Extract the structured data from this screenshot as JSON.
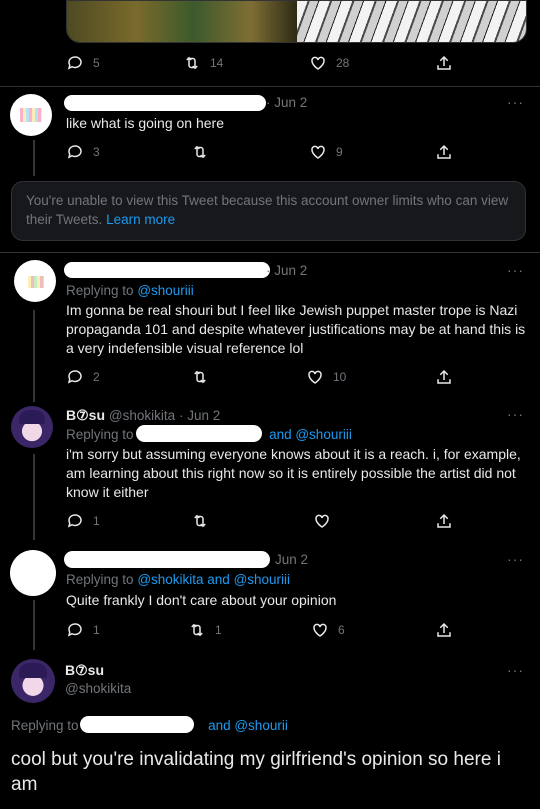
{
  "top_tweet": {
    "actions": {
      "replies": "5",
      "retweets": "14",
      "likes": "28"
    }
  },
  "tweet1": {
    "date": "· Jun 2",
    "text": "like what is going on here",
    "actions": {
      "replies": "3",
      "retweets": "",
      "likes": "9"
    }
  },
  "notice": {
    "text": "You're unable to view this Tweet because this account owner limits who can view their Tweets.",
    "link": "Learn more"
  },
  "tweet2": {
    "date": "· Jun 2",
    "replying_label": "Replying to",
    "replying_to": "@shouriii",
    "text": "Im gonna be real shouri but I feel like Jewish puppet master trope is Nazi propaganda 101 and despite whatever justifications may be at hand this is a very indefensible visual reference lol",
    "actions": {
      "replies": "2",
      "retweets": "",
      "likes": "10"
    }
  },
  "tweet3": {
    "name": "B⑦su",
    "handle": "@shokikita",
    "date": "· Jun 2",
    "replying_label": "Replying to",
    "replying_to": "and @shouriii",
    "text": "i'm sorry but assuming everyone knows about it is a reach. i, for example, am learning about this right now so it is entirely possible the artist did not know it either",
    "actions": {
      "replies": "1",
      "retweets": "",
      "likes": ""
    }
  },
  "tweet4": {
    "date": "Jun 2",
    "replying_label": "Replying to",
    "replying_to": "@shokikita and @shouriii",
    "text": "Quite frankly I don't care about your opinion",
    "actions": {
      "replies": "1",
      "retweets": "1",
      "likes": "6"
    }
  },
  "main_tweet": {
    "name": "B⑦su",
    "handle": "@shokikita",
    "replying_label": "Replying to",
    "replying_to": "and @shourii",
    "text": "cool but you're invalidating my girlfriend's opinion so here i am"
  },
  "more_label": "···",
  "colors": {
    "background": "#000000",
    "text": "#e7e9ea",
    "muted": "#71767b",
    "link": "#1d9bf0",
    "notice_bg": "#16181c"
  }
}
